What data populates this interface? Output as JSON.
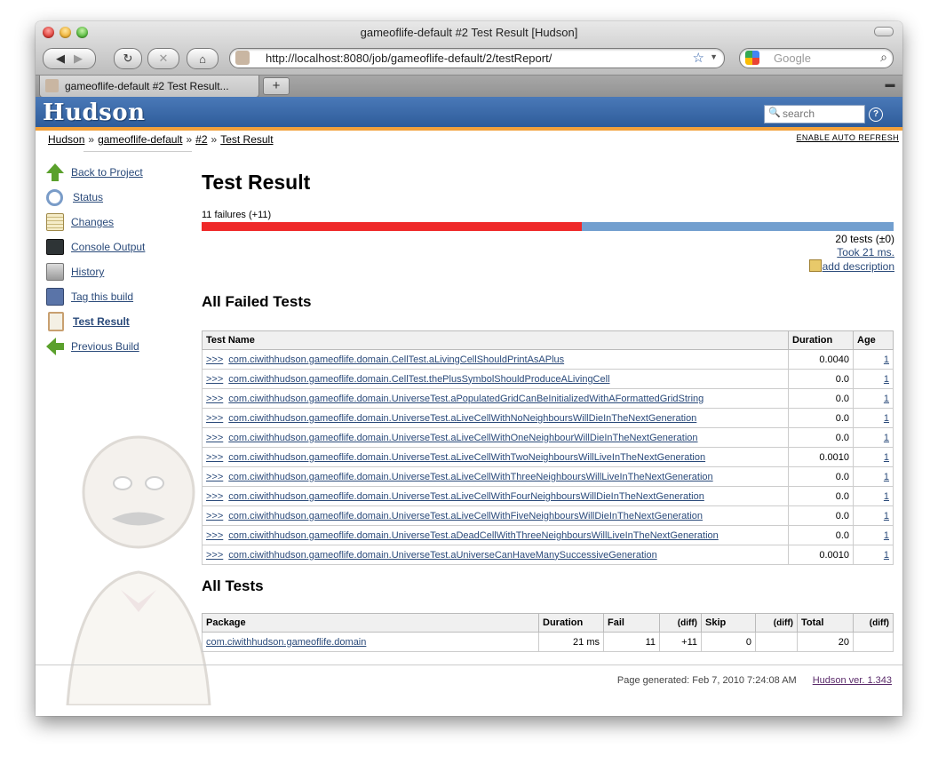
{
  "browser": {
    "window_title": "gameoflife-default #2 Test Result [Hudson]",
    "url": "http://localhost:8080/job/gameoflife-default/2/testReport/",
    "search_placeholder": "Google",
    "tab_title": "gameoflife-default #2 Test Result...",
    "new_tab_label": "+"
  },
  "header": {
    "logo": "Hudson",
    "search_placeholder": "search",
    "help_label": "?"
  },
  "breadcrumb": {
    "items": [
      "Hudson",
      "gameoflife-default",
      "#2",
      "Test Result"
    ],
    "separator": "»",
    "auto_refresh": "ENABLE AUTO REFRESH"
  },
  "sidebar": {
    "items": [
      {
        "label": "Back to Project",
        "icon": "up-arrow-icon",
        "color": "#5aa02c"
      },
      {
        "label": "Status",
        "icon": "magnifier-icon",
        "color": "#7a9cc8"
      },
      {
        "label": "Changes",
        "icon": "notepad-icon",
        "color": "#d6c68a"
      },
      {
        "label": "Console Output",
        "icon": "terminal-icon",
        "color": "#2e3436"
      },
      {
        "label": "History",
        "icon": "clock-icon",
        "color": "#9a9a9a"
      },
      {
        "label": "Tag this build",
        "icon": "save-icon",
        "color": "#5a74a8"
      },
      {
        "label": "Test Result",
        "icon": "clipboard-icon",
        "color": "#c8a070"
      },
      {
        "label": "Previous Build",
        "icon": "left-arrow-icon",
        "color": "#5aa02c"
      }
    ]
  },
  "result": {
    "title": "Test Result",
    "failures_label": "11 failures (+11)",
    "fail_fraction": 0.55,
    "tests_count": "20 tests (±0)",
    "took": "Took 21 ms.",
    "add_description": "add description"
  },
  "failed": {
    "heading": "All Failed Tests",
    "columns": [
      "Test Name",
      "Duration",
      "Age"
    ],
    "expander": ">>>",
    "rows": [
      {
        "name": "com.ciwithhudson.gameoflife.domain.CellTest.aLivingCellShouldPrintAsAPlus",
        "duration": "0.0040",
        "age": "1"
      },
      {
        "name": "com.ciwithhudson.gameoflife.domain.CellTest.thePlusSymbolShouldProduceALivingCell",
        "duration": "0.0",
        "age": "1"
      },
      {
        "name": "com.ciwithhudson.gameoflife.domain.UniverseTest.aPopulatedGridCanBeInitializedWithAFormattedGridString",
        "duration": "0.0",
        "age": "1"
      },
      {
        "name": "com.ciwithhudson.gameoflife.domain.UniverseTest.aLiveCellWithNoNeighboursWillDieInTheNextGeneration",
        "duration": "0.0",
        "age": "1"
      },
      {
        "name": "com.ciwithhudson.gameoflife.domain.UniverseTest.aLiveCellWithOneNeighbourWillDieInTheNextGeneration",
        "duration": "0.0",
        "age": "1"
      },
      {
        "name": "com.ciwithhudson.gameoflife.domain.UniverseTest.aLiveCellWithTwoNeighboursWillLiveInTheNextGeneration",
        "duration": "0.0010",
        "age": "1"
      },
      {
        "name": "com.ciwithhudson.gameoflife.domain.UniverseTest.aLiveCellWithThreeNeighboursWillLiveInTheNextGeneration",
        "duration": "0.0",
        "age": "1"
      },
      {
        "name": "com.ciwithhudson.gameoflife.domain.UniverseTest.aLiveCellWithFourNeighboursWillDieInTheNextGeneration",
        "duration": "0.0",
        "age": "1"
      },
      {
        "name": "com.ciwithhudson.gameoflife.domain.UniverseTest.aLiveCellWithFiveNeighboursWillDieInTheNextGeneration",
        "duration": "0.0",
        "age": "1"
      },
      {
        "name": "com.ciwithhudson.gameoflife.domain.UniverseTest.aDeadCellWithThreeNeighboursWillLiveInTheNextGeneration",
        "duration": "0.0",
        "age": "1"
      },
      {
        "name": "com.ciwithhudson.gameoflife.domain.UniverseTest.aUniverseCanHaveManySuccessiveGeneration",
        "duration": "0.0010",
        "age": "1"
      }
    ]
  },
  "all": {
    "heading": "All Tests",
    "columns": [
      "Package",
      "Duration",
      "Fail",
      "(diff)",
      "Skip",
      "(diff)",
      "Total",
      "(diff)"
    ],
    "rows": [
      {
        "package": "com.ciwithhudson.gameoflife.domain",
        "duration": "21 ms",
        "fail": "11",
        "fail_diff": "+11",
        "skip": "0",
        "skip_diff": "",
        "total": "20",
        "total_diff": ""
      }
    ]
  },
  "footer": {
    "generated": "Page generated: Feb 7, 2010 7:24:08 AM",
    "version": "Hudson ver. 1.343"
  }
}
